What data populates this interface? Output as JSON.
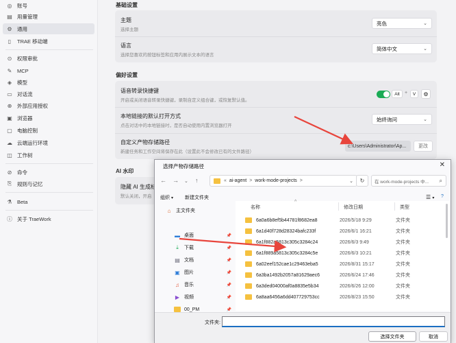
{
  "sidebar": {
    "items": [
      {
        "label": "账号",
        "icon": "account-icon"
      },
      {
        "label": "用量管理",
        "icon": "usage-icon"
      },
      {
        "label": "通用",
        "icon": "gear-icon",
        "active": true
      },
      {
        "label": "TRAE 移动端",
        "icon": "mobile-icon"
      },
      {
        "label": "权限审批",
        "icon": "permission-icon"
      },
      {
        "label": "MCP",
        "icon": "mcp-icon"
      },
      {
        "label": "模型",
        "icon": "model-icon"
      },
      {
        "label": "对话流",
        "icon": "chat-flow-icon"
      },
      {
        "label": "外部应用授权",
        "icon": "external-app-icon"
      },
      {
        "label": "浏览器",
        "icon": "browser-icon"
      },
      {
        "label": "电脑控制",
        "icon": "computer-control-icon"
      },
      {
        "label": "云端运行环境",
        "icon": "cloud-icon"
      },
      {
        "label": "工作树",
        "icon": "worktree-icon"
      },
      {
        "label": "命令",
        "icon": "command-icon"
      },
      {
        "label": "规则与记忆",
        "icon": "rules-icon"
      },
      {
        "label": "Beta",
        "icon": "beta-icon"
      },
      {
        "label": "关于 TraeWork",
        "icon": "info-icon"
      }
    ]
  },
  "main": {
    "basic_section_title": "基础设置",
    "theme": {
      "title": "主题",
      "desc": "选择主题",
      "value": "亮色"
    },
    "language": {
      "title": "语言",
      "desc": "选择您喜欢的按钮标签和应用内展示文本的语言",
      "value": "简体中文"
    },
    "pref_section_title": "偏好设置",
    "voice": {
      "title": "语音转录快捷键",
      "desc": "开启或关闭语音转录快捷键，录制自定义组合键，或恢复默认值。",
      "key1": "Alt",
      "plus": "+",
      "key2": "V"
    },
    "link": {
      "title": "本地链接的默认打开方式",
      "desc": "点击对话中的本地链接时，是否自动使用内置浏览器打开",
      "value": "始终询问"
    },
    "artifact": {
      "title": "自定义产物存储路径",
      "desc": "新建任务和工作空间将保存在此（设置此不会修改已有的文件路径）",
      "path": "c:\\Users\\Administrator\\Ap...",
      "change_label": "更改"
    },
    "ai_section_title": "AI 水印",
    "watermark": {
      "title": "隐藏 AI 生成标",
      "desc": "默认关闭，开启"
    }
  },
  "dialog": {
    "title": "选择产物存储路径",
    "breadcrumb": [
      "«",
      "ai-agent",
      ">",
      "work-mode-projects",
      ">"
    ],
    "search_placeholder": "在 work-mode-projects 中...",
    "organize_label": "组织",
    "new_folder_label": "新建文件夹",
    "view_label": "☰",
    "tree": [
      {
        "label": "主文件夹",
        "icon": "home-icon"
      },
      {
        "label": "桌面",
        "icon": "desktop-icon"
      },
      {
        "label": "下载",
        "icon": "download-icon"
      },
      {
        "label": "文档",
        "icon": "document-icon"
      },
      {
        "label": "图片",
        "icon": "picture-icon"
      },
      {
        "label": "音乐",
        "icon": "music-icon"
      },
      {
        "label": "视频",
        "icon": "video-icon"
      },
      {
        "label": "00_PM",
        "icon": "folder-icon"
      }
    ],
    "columns": {
      "name": "名称",
      "date": "修改日期",
      "type": "类型"
    },
    "files": [
      {
        "name": "6a0a6b8ef5b44781f8682ea8",
        "date": "2026/5/18 9:29",
        "type": "文件夹"
      },
      {
        "name": "6a1d40f728d28324bafc233f",
        "date": "2026/6/1 16:21",
        "type": "文件夹"
      },
      {
        "name": "6a1f882a5813c305c3284c24",
        "date": "2026/6/3 9:49",
        "type": "文件夹"
      },
      {
        "name": "6a1f889a5813c305c3284c5e",
        "date": "2026/6/3 10:21",
        "type": "文件夹"
      },
      {
        "name": "6a02eef152cae1c29463eba5",
        "date": "2026/8/31 15:17",
        "type": "文件夹"
      },
      {
        "name": "6a3ba1492b2057a81629aec6",
        "date": "2026/6/24 17:46",
        "type": "文件夹"
      },
      {
        "name": "6a3ded04000af0a8835e5b34",
        "date": "2026/6/26 12:00",
        "type": "文件夹"
      },
      {
        "name": "6a8aa6456a6dd407729753cc",
        "date": "2026/8/23 15:50",
        "type": "文件夹"
      }
    ],
    "filename_label": "文件夹:",
    "filename_value": "",
    "select_button": "选择文件夹",
    "cancel_button": "取消"
  },
  "colors": {
    "toggle_on": "#1aab55",
    "annotation_arrow": "#e8453c",
    "primary_border": "#1b6ec2"
  }
}
